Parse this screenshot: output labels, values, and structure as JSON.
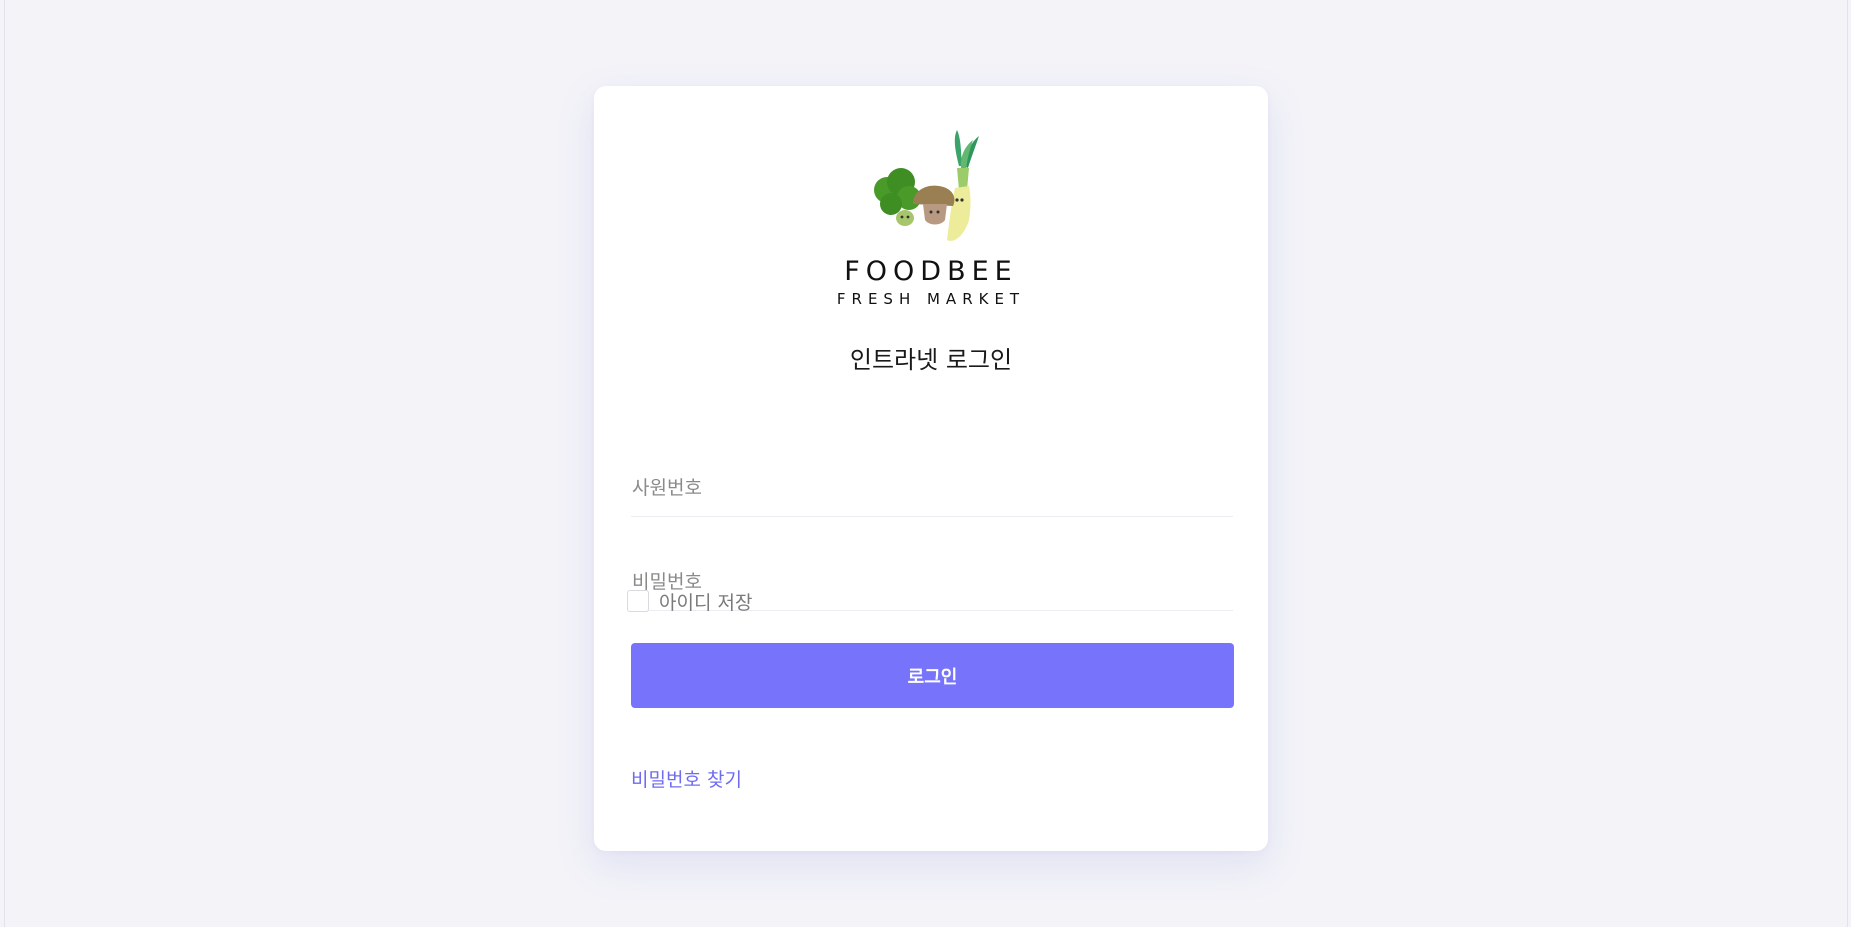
{
  "brand": {
    "name": "FOODBEE",
    "tagline": "FRESH MARKET"
  },
  "login": {
    "title": "인트라넷 로그인",
    "employee_id_placeholder": "사원번호",
    "password_placeholder": "비밀번호",
    "remember_label": "아이디 저장",
    "submit_label": "로그인",
    "find_password_label": "비밀번호 찾기"
  },
  "colors": {
    "accent": "#7774fb",
    "link": "#6f6cf0",
    "background": "#f3f3f8"
  },
  "icons": {
    "logo": "vegetables-mascot-logo"
  }
}
